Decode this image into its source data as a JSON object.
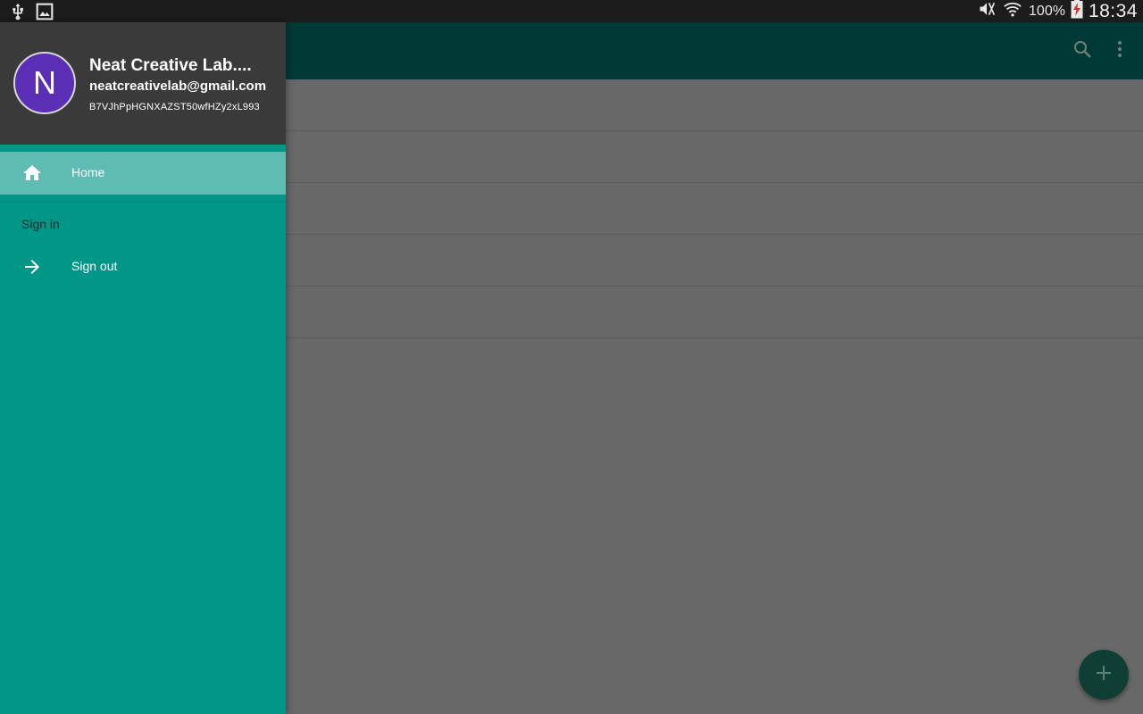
{
  "status_bar": {
    "battery_percent": "100%",
    "time": "18:34",
    "left_icons": [
      "usb-icon",
      "image-icon"
    ],
    "right_icons": [
      "mute-icon",
      "wifi-icon",
      "battery-charging-icon"
    ]
  },
  "app_bar": {
    "actions": [
      "search-icon",
      "more-vert-icon"
    ]
  },
  "drawer": {
    "avatar_letter": "N",
    "user_name": "Neat Creative Lab....",
    "user_email": "neatcreativelab@gmail.com",
    "user_id": "B7VJhPpHGNXAZST50wfHZy2xL993",
    "items": [
      {
        "label": "Home",
        "icon": "home-icon",
        "selected": true
      }
    ],
    "section_header": "Sign in",
    "section_items": [
      {
        "label": "Sign out",
        "icon": "arrow-right-icon"
      }
    ]
  },
  "fab": {
    "icon": "plus-icon"
  },
  "colors": {
    "drawer_bg": "#009688",
    "drawer_selected": "#5ebcb2",
    "header_bg": "#3a3a3a",
    "avatar_bg": "#5a2fb5",
    "app_bar_dimmed": "#003a36",
    "scrim_content": "#686868"
  }
}
